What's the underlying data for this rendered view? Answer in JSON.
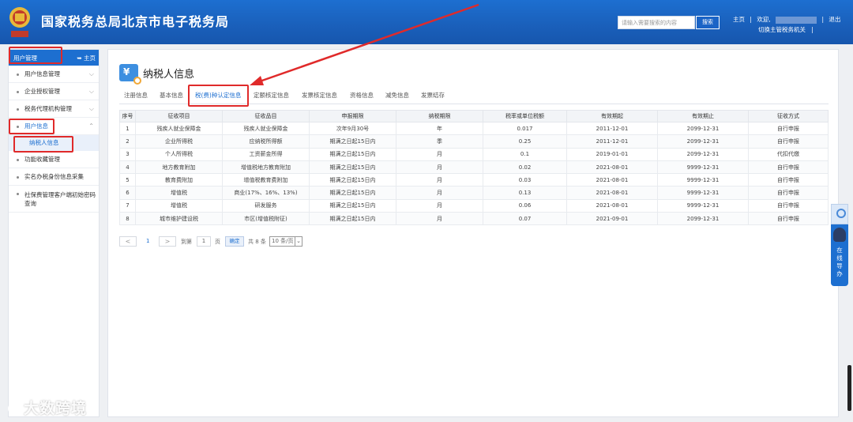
{
  "header": {
    "title": "国家税务总局北京市电子税务局",
    "search_placeholder": "请输入需要搜索的内容",
    "search_button": "搜索",
    "links": {
      "home": "主页",
      "sep1": "|",
      "welcome": "欢迎,",
      "sep2": "|",
      "logout": "退出",
      "switch": "切换主管税务机关",
      "sep3": "|"
    }
  },
  "sidebar": {
    "title": "用户管理",
    "home": "主页",
    "items": [
      {
        "label": "用户信息管理",
        "chev": "⌵"
      },
      {
        "label": "企业授权管理",
        "chev": "⌵"
      },
      {
        "label": "税务代理机构管理",
        "chev": "⌵"
      },
      {
        "label": "用户信息",
        "chev": "⌃"
      },
      {
        "label": "纳税人信息"
      },
      {
        "label": "功能收藏管理"
      },
      {
        "label": "实名办税身份信息采集"
      },
      {
        "label": "社保费管理客户端初始密码查询"
      }
    ]
  },
  "main": {
    "title": "纳税人信息",
    "tabs": [
      "注册信息",
      "基本信息",
      "税(费)种认定信息",
      "定额核定信息",
      "发票核定信息",
      "资格信息",
      "减免信息",
      "发票结存"
    ],
    "table": {
      "headers": [
        "序号",
        "征收项目",
        "征收品目",
        "申报期限",
        "纳税期限",
        "税率或单位税额",
        "有效期起",
        "有效期止",
        "征收方式"
      ],
      "rows": [
        [
          "1",
          "残疾人就业保障金",
          "残疾人就业保障金",
          "次年9月30号",
          "年",
          "0.017",
          "2011-12-01",
          "2099-12-31",
          "自行申报"
        ],
        [
          "2",
          "企业所得税",
          "应纳税所得额",
          "期满之日起15日内",
          "季",
          "0.25",
          "2011-12-01",
          "2099-12-31",
          "自行申报"
        ],
        [
          "3",
          "个人所得税",
          "工资薪金所得",
          "期满之日起15日内",
          "月",
          "0.1",
          "2019-01-01",
          "2099-12-31",
          "代扣代缴"
        ],
        [
          "4",
          "地方教育附加",
          "增值税地方教育附加",
          "期满之日起15日内",
          "月",
          "0.02",
          "2021-08-01",
          "9999-12-31",
          "自行申报"
        ],
        [
          "5",
          "教育费附加",
          "增值税教育费附加",
          "期满之日起15日内",
          "月",
          "0.03",
          "2021-08-01",
          "9999-12-31",
          "自行申报"
        ],
        [
          "6",
          "增值税",
          "商业(17%、16%、13%)",
          "期满之日起15日内",
          "月",
          "0.13",
          "2021-08-01",
          "9999-12-31",
          "自行申报"
        ],
        [
          "7",
          "增值税",
          "研发服务",
          "期满之日起15日内",
          "月",
          "0.06",
          "2021-08-01",
          "9999-12-31",
          "自行申报"
        ],
        [
          "8",
          "城市维护建设税",
          "市区(增值税附征)",
          "期满之日起15日内",
          "月",
          "0.07",
          "2021-09-01",
          "2099-12-31",
          "自行申报"
        ]
      ]
    },
    "pager": {
      "prev": "<",
      "current": "1",
      "next": ">",
      "goto_label": "到第",
      "page_input": "1",
      "page_unit": "页",
      "confirm": "确定",
      "total": "共 8 条",
      "page_size": "10 条/页"
    }
  },
  "float_widget": {
    "label": "在线导办"
  },
  "watermark": "大数跨境",
  "colors": {
    "primary": "#1d6fd0",
    "highlight": "#e02a2a"
  }
}
